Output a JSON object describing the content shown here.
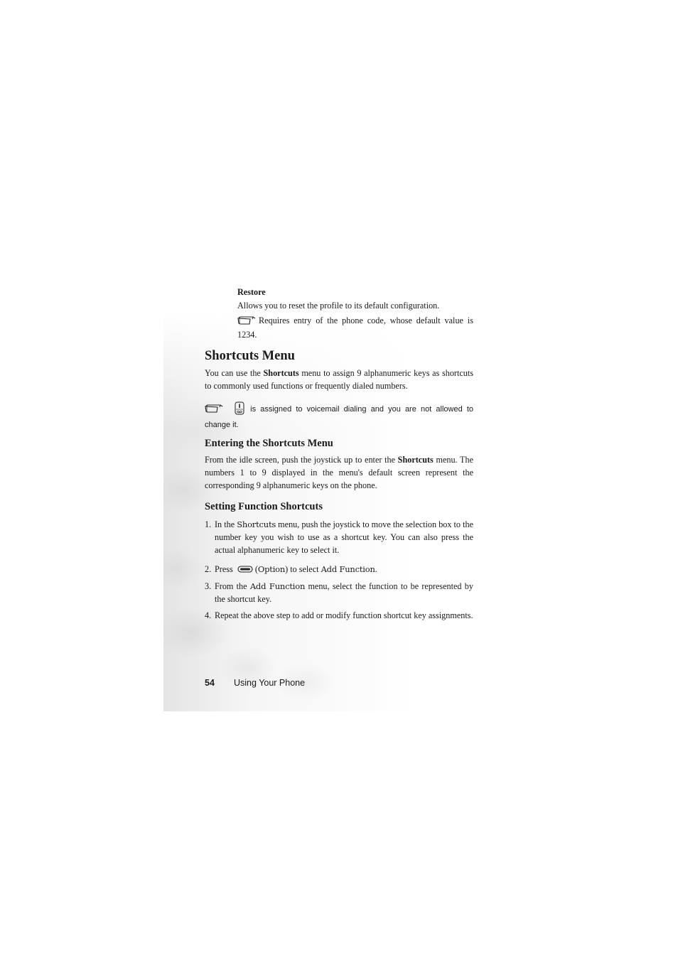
{
  "restore": {
    "title": "Restore",
    "description": "Allows you to reset the profile to its default configuration.",
    "note": "Requires entry of the phone code, whose default value is 1234."
  },
  "shortcuts_menu": {
    "heading": "Shortcuts Menu",
    "intro_before": "You can use the ",
    "intro_bold": "Shortcuts",
    "intro_after": " menu to assign 9 alphanumeric keys as shortcuts to commonly used functions or frequently dialed numbers.",
    "note": "is assigned to voicemail dialing and you are not allowed to change it."
  },
  "entering": {
    "heading": "Entering the Shortcuts Menu",
    "text_before": "From the idle screen, push the joystick up to enter the ",
    "text_bold": "Shortcuts",
    "text_after": " menu. The numbers 1 to 9 displayed in the menu's default screen represent the corresponding 9 alphanumeric keys on the phone."
  },
  "setting": {
    "heading": "Setting Function Shortcuts",
    "steps": [
      {
        "num": "1.",
        "before": "In the ",
        "term": "Shortcuts",
        "after": " menu, push the joystick to move the selection box to the number key you wish to use as a shortcut key. You can also press the actual alphanumeric key to select it."
      },
      {
        "num": "2.",
        "before": "Press ",
        "paren_open": " (",
        "term": "Option",
        "mid": ") to select ",
        "term2": "Add Function",
        "after": "."
      },
      {
        "num": "3.",
        "before": "From the ",
        "term": "Add Function",
        "after": " menu, select the function to be represented by the shortcut key."
      },
      {
        "num": "4.",
        "text": "Repeat the above step to add or modify function shortcut key assignments."
      }
    ]
  },
  "footer": {
    "page_number": "54",
    "section": "Using Your Phone"
  }
}
